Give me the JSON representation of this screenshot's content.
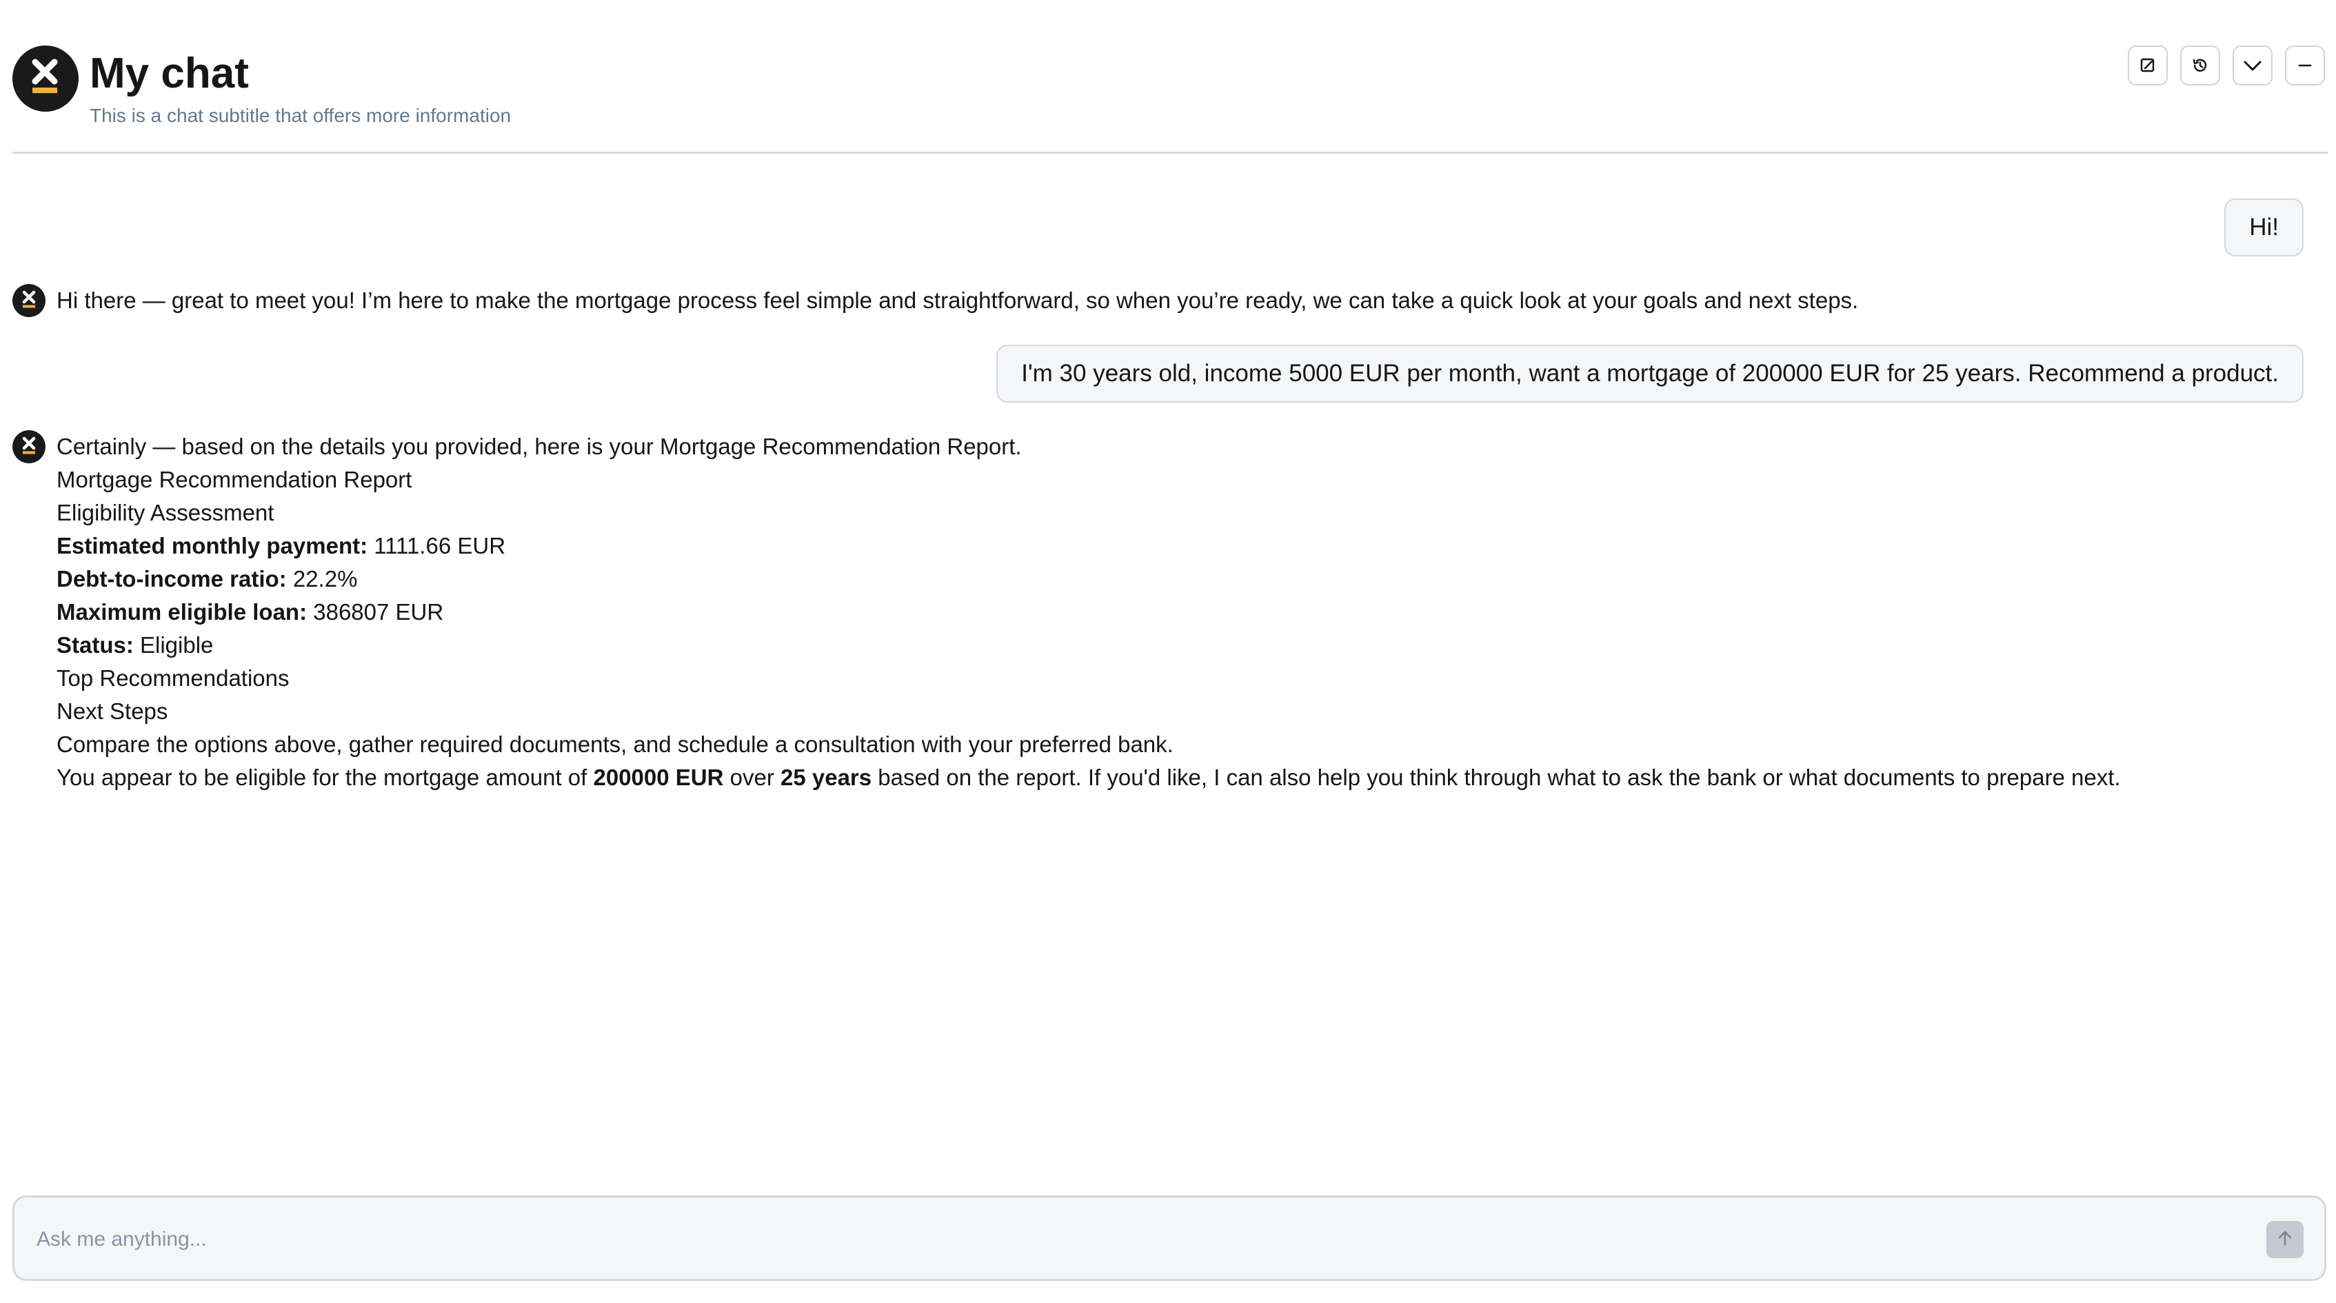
{
  "header": {
    "title": "My chat",
    "subtitle": "This is a chat subtitle that offers more information",
    "buttons": [
      {
        "icon": "edit-icon",
        "label": "New chat"
      },
      {
        "icon": "history-icon",
        "label": "History"
      },
      {
        "icon": "chevron-down-icon",
        "label": "Collapse"
      },
      {
        "icon": "minimize-icon",
        "label": "Minimize"
      }
    ]
  },
  "messages": {
    "user_1": "Hi!",
    "bot_1": "Hi there — great to meet you! I’m here to make the mortgage process feel simple and straightforward, so when you’re ready, we can take a quick look at your goals and next steps.",
    "user_2": "I'm 30 years old, income 5000 EUR per month, want a mortgage of 200000 EUR for 25 years. Recommend a product.",
    "bot_2": {
      "intro": "Certainly — based on the details you provided, here is your Mortgage Recommendation Report.",
      "report_title": "Mortgage Recommendation Report",
      "section_eligibility": "Eligibility Assessment",
      "monthly_payment_label": "Estimated monthly payment:",
      "monthly_payment_value": " 1111.66 EUR",
      "dti_label": "Debt-to-income ratio:",
      "dti_value": " 22.2%",
      "max_loan_label": "Maximum eligible loan:",
      "max_loan_value": " 386807 EUR",
      "status_label": "Status:",
      "status_value": " Eligible",
      "section_recommendations": "Top Recommendations",
      "section_next_steps": "Next Steps",
      "next_steps_text": "Compare the options above, gather required documents, and schedule a consultation with your preferred bank.",
      "closing_part1": "You appear to be eligible for the mortgage amount of ",
      "closing_amount": "200000 EUR",
      "closing_part2": " over ",
      "closing_term": "25 years",
      "closing_part3": " based on the report. If you'd like, I can also help you think through what to ask the bank or what documents to prepare next."
    }
  },
  "composer": {
    "placeholder": "Ask me anything...",
    "value": "",
    "send_icon": "arrow-up-icon"
  },
  "colors": {
    "brand_dark": "#1a1a1a",
    "brand_accent": "#f2b233",
    "border": "#d4d8de",
    "subtitle": "#6b7588",
    "bubble_bg": "#f5f6f8"
  }
}
